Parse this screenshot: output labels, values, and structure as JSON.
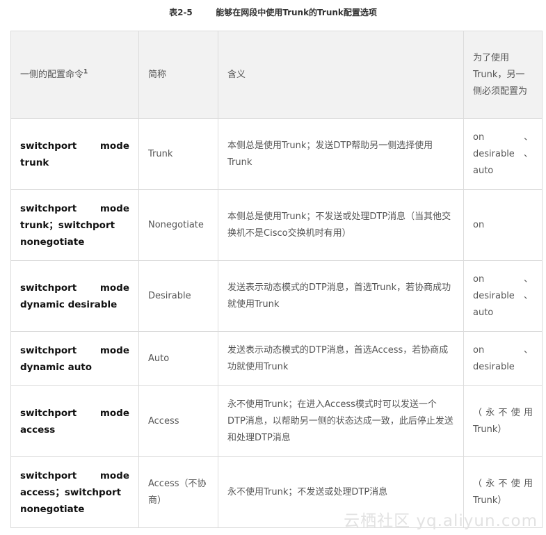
{
  "caption": "表2-5        能够在网段中使用Trunk的Trunk配置选项",
  "headers": {
    "command": "一侧的配置命令",
    "command_sup": "1",
    "short": "简称",
    "meaning": "含义",
    "other_side": "为了使用Trunk，另一侧必须配置为"
  },
  "rows": [
    {
      "command": "switchport mode trunk",
      "short": "Trunk",
      "meaning": "本侧总是使用Trunk；发送DTP帮助另一侧选择使用Trunk",
      "other_side": "on、desirable、auto"
    },
    {
      "command": "switchport mode trunk；switchport nonegotiate",
      "short": "Nonegotiate",
      "meaning": "本侧总是使用Trunk；不发送或处理DTP消息（当其他交换机不是Cisco交换机时有用）",
      "other_side": "on"
    },
    {
      "command": "switchport mode dynamic desirable",
      "short": "Desirable",
      "meaning": "发送表示动态模式的DTP消息，首选Trunk，若协商成功就使用Trunk",
      "other_side": "on、desirable、auto"
    },
    {
      "command": "switchport mode dynamic auto",
      "short": "Auto",
      "meaning": "发送表示动态模式的DTP消息，首选Access，若协商成功就使用Trunk",
      "other_side": "on、desirable"
    },
    {
      "command": "switchport mode access",
      "short": "Access",
      "meaning": "永不使用Trunk；在进入Access模式时可以发送一个DTP消息，以帮助另一侧的状态达成一致，此后停止发送和处理DTP消息",
      "other_side": "（永不使用Trunk）"
    },
    {
      "command": "switchport mode access；switchport nonegotiate",
      "short": "Access（不协商）",
      "meaning": "永不使用Trunk；不发送或处理DTP消息",
      "other_side": "（永不使用Trunk）"
    }
  ],
  "watermark": "云栖社区 yq.aliyun.com"
}
